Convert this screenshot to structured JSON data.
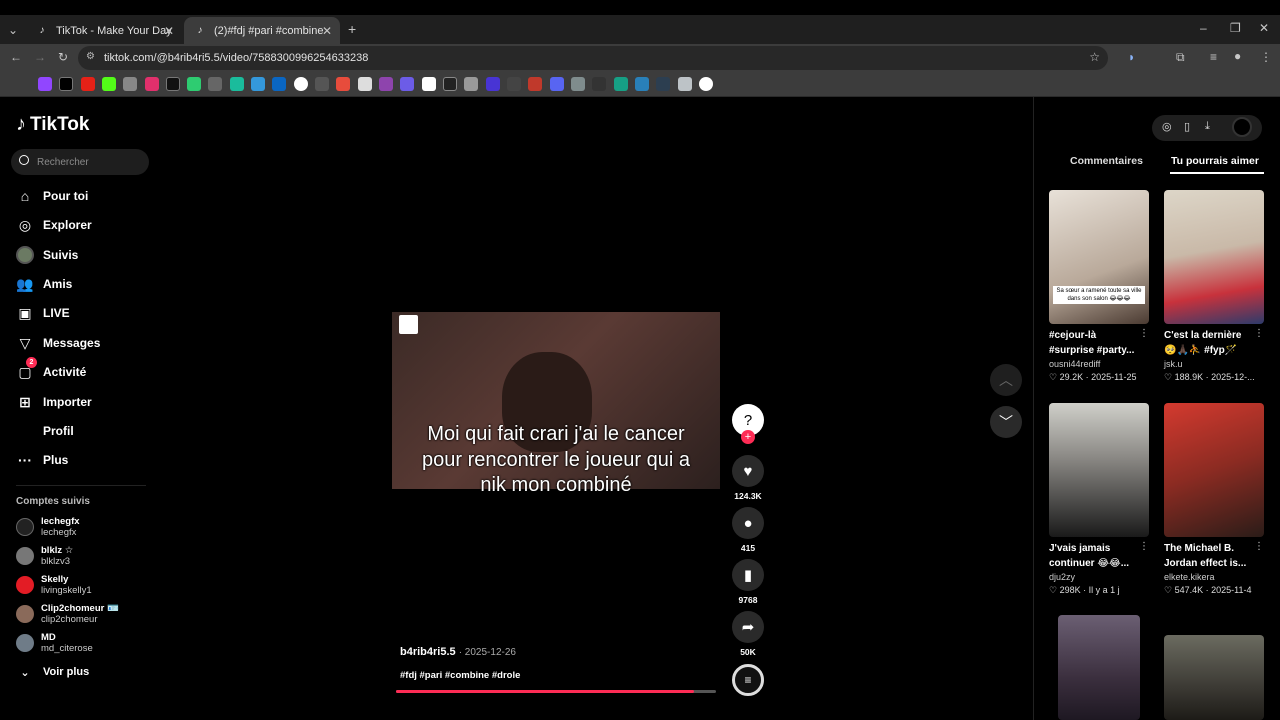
{
  "browser": {
    "tabs": [
      {
        "title": "TikTok - Make Your Day"
      },
      {
        "title": "(2)#fdj #pari #combine #drole"
      }
    ],
    "url": "tiktok.com/@b4rib4ri5.5/video/7588300996254633238"
  },
  "tiktok": {
    "logo": "TikTok",
    "search_placeholder": "Rechercher",
    "nav": [
      {
        "label": "Pour toi",
        "icon": "home-icon"
      },
      {
        "label": "Explorer",
        "icon": "compass-icon"
      },
      {
        "label": "Suivis",
        "icon": "following-avatar"
      },
      {
        "label": "Amis",
        "icon": "friends-icon"
      },
      {
        "label": "LIVE",
        "icon": "live-icon"
      },
      {
        "label": "Messages",
        "icon": "messages-icon"
      },
      {
        "label": "Activité",
        "icon": "activity-icon",
        "badge": "2"
      },
      {
        "label": "Importer",
        "icon": "upload-icon"
      },
      {
        "label": "Profil",
        "icon": "profile-avatar"
      },
      {
        "label": "Plus",
        "icon": "more-icon"
      }
    ],
    "followed_title": "Comptes suivis",
    "followed": [
      {
        "name": "lechegfx",
        "handle": "lechegfx"
      },
      {
        "name": "blklz ☆",
        "handle": "blklzv3"
      },
      {
        "name": "Skelly",
        "handle": "livingskelly1"
      },
      {
        "name": "Clip2chomeur 🪪",
        "handle": "clip2chomeur"
      },
      {
        "name": "MD",
        "handle": "md_citerose"
      }
    ],
    "see_more": "Voir plus",
    "video": {
      "caption": "Moi qui fait crari j'ai le cancer pour rencontrer le joueur qui a nik mon combiné",
      "author": "b4rib4ri5.5",
      "date": "· 2025-12-26",
      "hashtags": "#fdj #pari #combine #drole",
      "progress": 0.93
    },
    "actions": {
      "likes": "124.3K",
      "comments": "415",
      "saves": "9768",
      "shares": "50K"
    },
    "right_panel": {
      "tab_comments": "Commentaires",
      "tab_suggest": "Tu pourrais aimer",
      "cards": [
        {
          "title": "#cejour-là #surprise #party...",
          "user": "ousni44rediff",
          "meta": "♡ 29.2K · 2025-11-25",
          "overlay": "Sa sœur a ramené toute sa ville dans son salon 😂😂😂"
        },
        {
          "title": "C'est la dernière 🥺🙏🏿⛹️ #fyp🪄",
          "user": "jsk.u",
          "meta": "♡ 188.9K · 2025-12-...",
          "overlay": ""
        },
        {
          "title": "J'vais jamais continuer 😂😂...",
          "user": "dju2zy",
          "meta": "♡ 298K · Il y a 1 j",
          "overlay": ""
        },
        {
          "title": "The Michael B. Jordan effect is...",
          "user": "elkete.kikera",
          "meta": "♡ 547.4K · 2025-11-4",
          "overlay": ""
        }
      ]
    }
  }
}
